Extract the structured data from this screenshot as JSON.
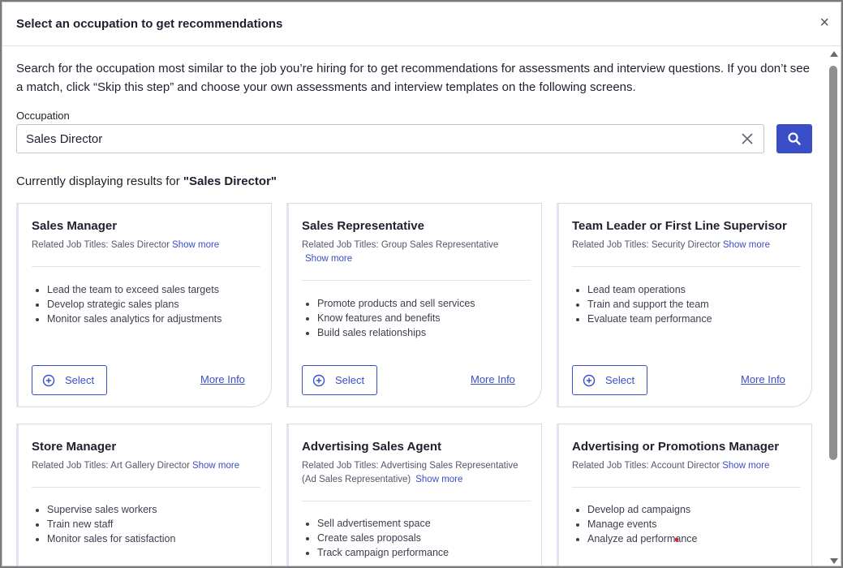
{
  "modal": {
    "title": "Select an occupation to get recommendations",
    "close_label": "×"
  },
  "intro": "Search for the occupation most similar to the job you’re hiring for to get recommendations for assessments and interview questions. If you don’t see a match, click “Skip this step” and choose your own assessments and interview templates on the following screens.",
  "search": {
    "label": "Occupation",
    "value": "Sales Director"
  },
  "results": {
    "prefix": "Currently displaying results for ",
    "query": "\"Sales Director\""
  },
  "cards": [
    {
      "title": "Sales Manager",
      "related_prefix": "Related Job Titles: ",
      "related": "Sales Director",
      "show_more": "Show more",
      "bullets": [
        "Lead the team to exceed sales targets",
        "Develop strategic sales plans",
        "Monitor sales analytics for adjustments"
      ],
      "select_label": "Select",
      "more_info_label": "More Info"
    },
    {
      "title": "Sales Representative",
      "related_prefix": "Related Job Titles: ",
      "related": "Group Sales Representative",
      "show_more": "Show more",
      "bullets": [
        "Promote products and sell services",
        "Know features and benefits",
        "Build sales relationships"
      ],
      "select_label": "Select",
      "more_info_label": "More Info"
    },
    {
      "title": "Team Leader or First Line Supervisor",
      "related_prefix": "Related Job Titles: ",
      "related": "Security Director",
      "show_more": "Show more",
      "bullets": [
        "Lead team operations",
        "Train and support the team",
        "Evaluate team performance"
      ],
      "select_label": "Select",
      "more_info_label": "More Info"
    },
    {
      "title": "Store Manager",
      "related_prefix": "Related Job Titles: ",
      "related": "Art Gallery Director",
      "show_more": "Show more",
      "bullets": [
        "Supervise sales workers",
        "Train new staff",
        "Monitor sales for satisfaction"
      ]
    },
    {
      "title": "Advertising Sales Agent",
      "related_prefix": "Related Job Titles: ",
      "related": "Advertising Sales Representative (Ad Sales Representative)",
      "show_more": "Show more",
      "bullets": [
        "Sell advertisement space",
        "Create sales proposals",
        "Track campaign performance"
      ]
    },
    {
      "title": "Advertising or Promotions Manager",
      "related_prefix": "Related Job Titles: ",
      "related": "Account Director",
      "show_more": "Show more",
      "bullets": [
        "Develop ad campaigns",
        "Manage events",
        "Analyze ad performance"
      ]
    }
  ],
  "colors": {
    "accent": "#3a4fc7",
    "text": "#1f1f2e",
    "muted": "#55556a"
  },
  "icons": {
    "close": "close-icon",
    "clear": "clear-icon",
    "search": "search-icon",
    "select": "plus-circle-icon"
  }
}
